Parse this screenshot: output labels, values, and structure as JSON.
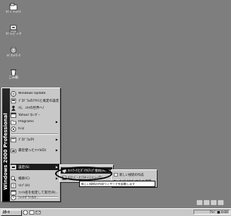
{
  "desktop": {
    "icons": [
      {
        "label": "ﾏｲ ﾄﾞｷｭﾒﾝﾄ",
        "icon": "my-documents-icon"
      },
      {
        "label": "ﾏｲ ｺﾝﾋﾟｭｰﾀ",
        "icon": "my-computer-icon"
      },
      {
        "label": "ﾏｲ ﾈｯﾄﾜｰｸ",
        "icon": "my-network-icon"
      },
      {
        "label": "ごみ箱",
        "icon": "recycle-bin-icon"
      }
    ]
  },
  "start_menu": {
    "banner": "Windows 2000 Professional",
    "top_items": [
      {
        "label": "Windows Update",
        "icon": "globe-icon"
      },
      {
        "label": "ﾌﾟﾛｸﾞﾗﾑのｱｸｾｽと既定の設定",
        "icon": "programs-defaults-icon"
      },
      {
        "label": "ﾒﾓ、ﾉﾙﾏの世界へ！",
        "icon": "user-icon"
      },
      {
        "label": "Yahoo! ｶﾚﾝﾀﾞｰ",
        "icon": "calendar-icon"
      },
      {
        "label": "Programs",
        "icon": "folder-icon",
        "arrow": "▶"
      },
      {
        "label": "ICQ",
        "icon": "flower-icon"
      }
    ],
    "items": [
      {
        "label": "ﾌﾟﾛｸﾞﾗﾑ(P)",
        "icon": "programs-icon",
        "arrow": "▶"
      },
      {
        "label": "最近使ったﾌｧｲﾙ(D)",
        "icon": "documents-icon",
        "arrow": "▶"
      },
      {
        "label": "設定(S)",
        "icon": "settings-icon",
        "arrow": "▶"
      },
      {
        "label": "検索(C)",
        "icon": "search-icon",
        "arrow": "▶"
      },
      {
        "label": "ﾍﾙﾌﾟ(H)",
        "icon": "help-icon"
      },
      {
        "label": "ﾌｧｲﾙ名を指定して実行(R)...",
        "icon": "run-icon"
      },
      {
        "label": "ｼｬｯﾄﾀﾞｳﾝ(U)...",
        "icon": "shutdown-icon"
      }
    ]
  },
  "settings_submenu": {
    "items": [
      {
        "label": "ﾈｯﾄﾜｰｸとﾀﾞｲﾔﾙｱｯﾌﾟ接続(N)",
        "arrow": "▶"
      },
      {
        "label": "ﾀｽｸ ﾊﾞｰと[ｽﾀｰﾄ] ﾒﾆｭｰ(T)..."
      }
    ]
  },
  "network_submenu": {
    "items": [
      {
        "label": "新しい接続の作成"
      },
      {
        "label": "ﾈｯﾄﾜｰｸとﾀﾞｲﾔﾙｱｯﾌﾟ接続"
      }
    ]
  },
  "tooltip": "新しい接続の作成ウィザードを起動します",
  "taskbar": {
    "start_label": "ｽﾀｰﾄ",
    "clock": "ｱﾘﾊﾞ ■ 0:00"
  }
}
